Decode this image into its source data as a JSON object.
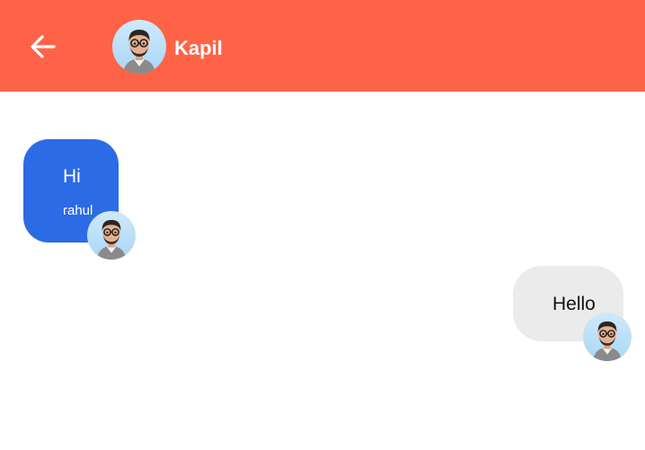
{
  "header": {
    "contact_name": "Kapil",
    "bg_color": "#ff6347",
    "back_icon": "arrow-left-icon",
    "avatar_icon": "memoji-avatar"
  },
  "messages": [
    {
      "direction": "incoming",
      "text": "Hi",
      "sender": "rahul",
      "bubble_color": "#2c6be6",
      "avatar_icon": "memoji-avatar"
    },
    {
      "direction": "outgoing",
      "text": "Hello",
      "bubble_color": "#ebebeb",
      "avatar_icon": "memoji-avatar"
    }
  ]
}
